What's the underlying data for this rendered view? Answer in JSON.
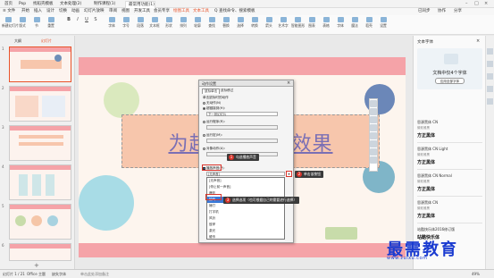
{
  "titlebar": {
    "tabs": [
      "首页",
      "Pop",
      "找稻壳模板",
      "文本处理(2)",
      "制作课程(1)",
      "最常用功能(1)"
    ],
    "active_tab": 5
  },
  "menu": {
    "items": [
      "≡ 文件",
      "开始",
      "插入",
      "设计",
      "切换",
      "动画",
      "幻灯片放映",
      "审阅",
      "视图",
      "开发工具",
      "会员专享",
      "绘图工具",
      "文本工具",
      "Q 查找命令、搜索模板"
    ],
    "right_items": [
      "已同步",
      "协作",
      "分享"
    ]
  },
  "ribbon": {
    "buttons": [
      "新建幻灯片",
      "版式",
      "节",
      "重置",
      "B",
      "I",
      "U",
      "S",
      "字体",
      "字号",
      "段落",
      "文本框",
      "形状",
      "排列",
      "轮廓",
      "查找",
      "替换",
      "选择",
      "转换",
      "箭头",
      "艺术字",
      "智能图形",
      "图表",
      "表格",
      "字体",
      "魔法",
      "稻壳",
      "设置"
    ]
  },
  "left_panel": {
    "tabs": [
      "大纲",
      "幻灯片"
    ],
    "slides": [
      "1",
      "2",
      "3",
      "4",
      "5",
      "6"
    ],
    "selected": 1,
    "add_label": "+"
  },
  "slide": {
    "title": "为超链接设置效果",
    "title_left": "为超链",
    "title_right": "效果"
  },
  "dialog": {
    "title": "动作设置",
    "tabs": [
      "鼠标单击",
      "鼠标移过"
    ],
    "section": "单击鼠标时的动作",
    "options": [
      {
        "label": "无动作(N)",
        "checked": false
      },
      {
        "label": "超链接到(H):",
        "checked": true
      },
      {
        "label": "运行程序(R):",
        "checked": false
      },
      {
        "label": "运行宏(M):",
        "checked": false
      },
      {
        "label": "对象动作(A):",
        "checked": false
      }
    ],
    "hyperlink_value": "下一张幻灯片",
    "play_sound_label": "播放声音(P):",
    "sound_value": "[无声音]",
    "list_items": [
      "[停止前一声音]",
      "爆炸",
      "抽气",
      "锤打",
      "打字机",
      "风铃",
      "鼓掌",
      "激光",
      "硬币",
      "照相机",
      "鼓声"
    ],
    "list_top": "[无声音]",
    "list_selected": 3,
    "ok": "确定",
    "cancel": "取消"
  },
  "callouts": [
    {
      "num": "1",
      "text": "勾选播放声音"
    },
    {
      "num": "2",
      "text": "单击该按钮"
    },
    {
      "num": "3",
      "text": "选择选项（也可根据自己的需要进行选择）"
    }
  ],
  "right_panel": {
    "header": "文本字体",
    "promo": "文档中仅4个字体",
    "promo_sub": "应用全部字体",
    "fonts": [
      {
        "name": "思源黑体 CN",
        "sub": "微软雅黑",
        "sample": "方正黑体"
      },
      {
        "name": "思源黑体 CN Light",
        "sub": "微软雅黑",
        "sample": "方正黑体"
      },
      {
        "name": "思源黑体 CN Normal",
        "sub": "微软雅黑",
        "sample": "方正黑体"
      },
      {
        "name": "思源黑体 CN",
        "sub": "微软雅黑",
        "sample": "方正黑体"
      }
    ],
    "bottom_title": "站酷快乐体2016修订版",
    "bottom_sample": "站酷快乐体"
  },
  "statusbar": {
    "left": [
      "幻灯片 1 / 21",
      "Office 主题",
      "缺失字体"
    ],
    "notes": "单击此处添加备注",
    "zoom": "49%"
  },
  "watermark": {
    "title": "最需教育",
    "url": "www.zuixu.com"
  }
}
